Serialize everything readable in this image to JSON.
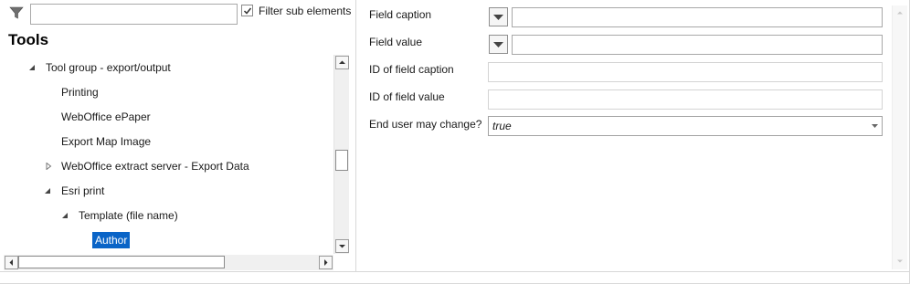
{
  "filter": {
    "input_value": "",
    "checkbox_checked": true,
    "checkbox_label": "Filter sub elements"
  },
  "tools": {
    "title": "Tools",
    "tree": [
      {
        "label": "Tool group - export/output",
        "level": 1,
        "expander": "expanded",
        "selected": false
      },
      {
        "label": "Printing",
        "level": 2,
        "expander": "none",
        "selected": false
      },
      {
        "label": "WebOffice ePaper",
        "level": 2,
        "expander": "none",
        "selected": false
      },
      {
        "label": "Export Map Image",
        "level": 2,
        "expander": "none",
        "selected": false
      },
      {
        "label": "WebOffice extract server - Export Data",
        "level": 2,
        "expander": "collapsed",
        "selected": false
      },
      {
        "label": "Esri print",
        "level": 2,
        "expander": "expanded",
        "selected": false
      },
      {
        "label": "Template (file name)",
        "level": 3,
        "expander": "expanded",
        "selected": false
      },
      {
        "label": "Author",
        "level": 4,
        "expander": "none",
        "selected": true
      }
    ]
  },
  "properties": {
    "field_caption": {
      "label": "Field caption",
      "value": ""
    },
    "field_value": {
      "label": "Field value",
      "value": ""
    },
    "id_field_caption": {
      "label": "ID of field caption",
      "value": ""
    },
    "id_field_value": {
      "label": "ID of field value",
      "value": ""
    },
    "end_user_change": {
      "label": "End user may change?",
      "value": "true"
    }
  },
  "colors": {
    "selection": "#0a64c7",
    "border": "#a8a8a8"
  }
}
